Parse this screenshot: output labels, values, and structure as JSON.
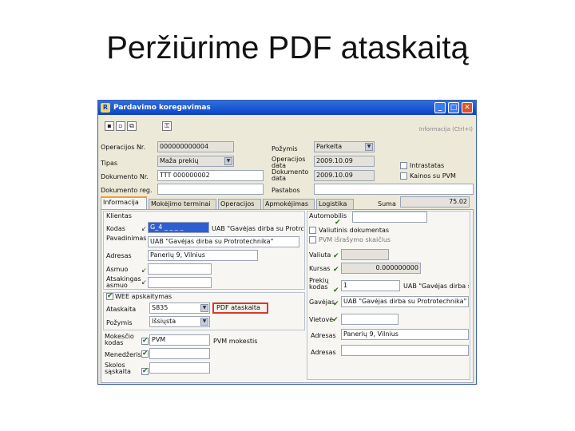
{
  "slide": {
    "title": "Peržiūrime PDF ataskaitą"
  },
  "window": {
    "title": "Pardavimo koregavimas",
    "hint": "Informacija (Ctrl+I)"
  },
  "toolbar": {
    "icons": [
      "save-icon",
      "save-new-icon",
      "copy-icon",
      "key-icon"
    ]
  },
  "header": {
    "operacijos_nr": {
      "label": "Operacijos Nr.",
      "value": "000000000004"
    },
    "tipas": {
      "label": "Tipas",
      "value": "Maža prekių"
    },
    "dokumento_nr": {
      "label": "Dokumento Nr.",
      "value": "TTT 000000002"
    },
    "dokumento_reg": {
      "label": "Dokumento reg.",
      "value": ""
    },
    "pozymis": {
      "label": "Požymis",
      "value": "Parkelta"
    },
    "operacijos_data": {
      "label": "Operacijos data",
      "value": "2009.10.09"
    },
    "dokumento_data": {
      "label": "Dokumento data",
      "value": "2009.10.09"
    },
    "pastabos": {
      "label": "Pastabos",
      "value": ""
    },
    "intrastatas": {
      "label": "Intrastatas"
    },
    "kainos_su_pvm": {
      "label": "Kainos su PVM"
    },
    "suma": {
      "label": "Suma",
      "value": "75.02"
    }
  },
  "tabs": [
    "Informacija",
    "Mokėjimo terminai",
    "Operacijos",
    "Apmokėjimas",
    "Logistika"
  ],
  "left": {
    "klientas_section": "Klientas",
    "kodas": {
      "label": "Kodas",
      "value": "G_4 _ _ _ _",
      "name": "UAB \"Gavėjas dirba su Protro..."
    },
    "pavadinimas": {
      "label": "Pavadinimas",
      "value": "UAB \"Gavėjas dirba su Protrotechnika\""
    },
    "adresas": {
      "label": "Adresas",
      "value": "Panerių 9, Vilnius"
    },
    "asmuo": {
      "label": "Asmuo",
      "value": ""
    },
    "atsakingas_asmuo": {
      "label": "Atsakingas asmuo",
      "value": ""
    },
    "wee": {
      "label": "WEE apskaitymas"
    },
    "ataskaita": {
      "label": "Ataskaita",
      "value": "S835"
    },
    "pdf_button": "PDF ataskaita",
    "pozymis": {
      "label": "Požymis",
      "value": "Išsiųsta"
    },
    "mokescio_kodas": {
      "label": "Mokesčio kodas",
      "value": "PVM",
      "desc": "PVM mokestis"
    },
    "menedzeris": {
      "label": "Menedžeris",
      "value": ""
    },
    "skolos_sąskaita": {
      "label": "Skolos sąskaita",
      "value": ""
    }
  },
  "right": {
    "automobilis": {
      "label": "Automobilis"
    },
    "valiutinis": {
      "label": "Valiutinis dokumentas"
    },
    "pvm_israsymas": {
      "label": "PVM išrašymo skaičius"
    },
    "valiuta": {
      "label": "Valiuta",
      "value": ""
    },
    "kursas": {
      "label": "Kursas",
      "value": "0.000000000"
    },
    "prekiu_kodas": {
      "label": "Prekių kodas",
      "value": "1",
      "name": "UAB \"Gavėjas dirba su..."
    },
    "gavejas": {
      "label": "Gavėjas",
      "value": "UAB \"Gavėjas dirba su Protrotechnika\""
    },
    "vietove": {
      "label": "Vietovė",
      "value": ""
    },
    "adresas": {
      "label": "Adresas",
      "value": "Panerių 9, Vilnius"
    },
    "adresas2": {
      "label": "Adresas",
      "value": ""
    }
  }
}
